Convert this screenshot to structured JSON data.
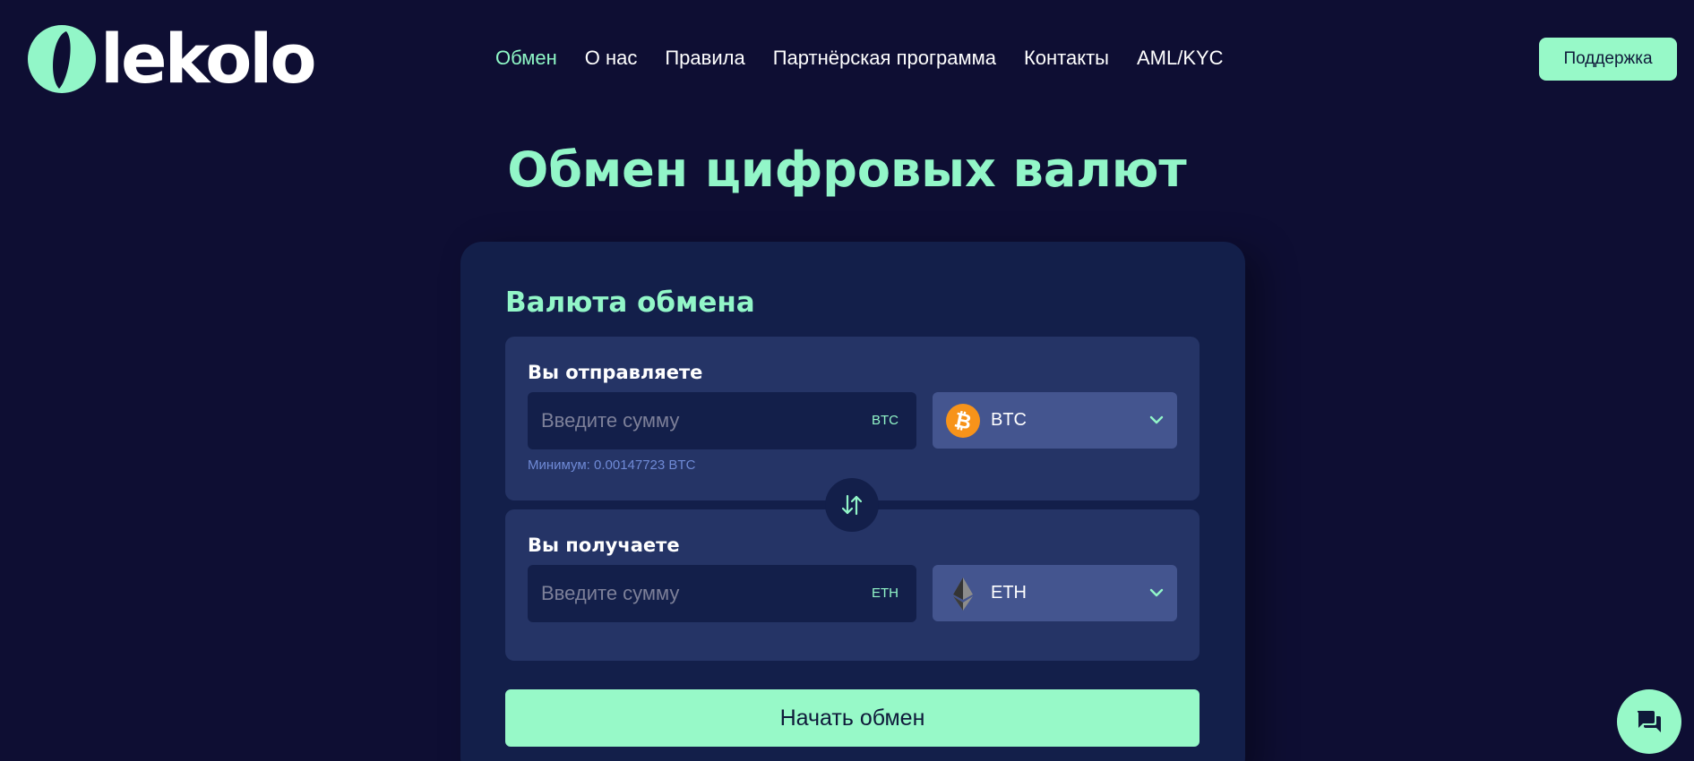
{
  "brand": {
    "logo_text": "lekolo",
    "accent_color": "#92f6c8",
    "background_color": "#0e0e33"
  },
  "nav": {
    "items": [
      {
        "label": "Обмен",
        "active": true
      },
      {
        "label": "О нас",
        "active": false
      },
      {
        "label": "Правила",
        "active": false
      },
      {
        "label": "Партнёрская программа",
        "active": false
      },
      {
        "label": "Контакты",
        "active": false
      },
      {
        "label": "AML/KYC",
        "active": false
      }
    ],
    "support_label": "Поддержка"
  },
  "main": {
    "title": "Обмен цифровых валют"
  },
  "exchange": {
    "section_title": "Валюта обмена",
    "send": {
      "label": "Вы отправляете",
      "placeholder": "Введите сумму",
      "unit": "BTC",
      "currency": "BTC",
      "currency_icon": "bitcoin-icon",
      "minimum_text": "Минимум: 0.00147723 BTC"
    },
    "receive": {
      "label": "Вы получаете",
      "placeholder": "Введите сумму",
      "unit": "ETH",
      "currency": "ETH",
      "currency_icon": "ethereum-icon"
    },
    "swap_icon": "swap-arrows-icon",
    "submit_label": "Начать обмен"
  },
  "chat": {
    "icon": "chat-icon"
  }
}
